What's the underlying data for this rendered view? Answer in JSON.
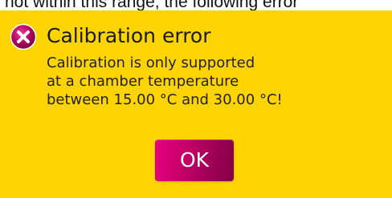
{
  "background_text": "not within this range, the following error",
  "dialog": {
    "icon": "error-circle-x-icon",
    "title": "Calibration error",
    "message_lines": [
      "Calibration is only supported",
      "at a chamber temperature",
      "between 15.00 °C and 30.00 °C!"
    ],
    "ok_label": "OK"
  },
  "colors": {
    "dialog_background": "#ffd400",
    "accent": "#c8006a",
    "icon_fill": "#b0005e",
    "text": "#1a1a1a",
    "button_text": "#ffffff"
  }
}
